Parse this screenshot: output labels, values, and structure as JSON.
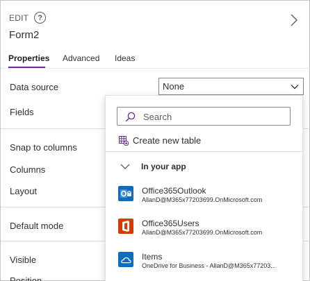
{
  "header": {
    "edit_label": "EDIT",
    "help_glyph": "?",
    "form_name": "Form2"
  },
  "tabs": [
    {
      "label": "Properties",
      "active": true
    },
    {
      "label": "Advanced",
      "active": false
    },
    {
      "label": "Ideas",
      "active": false
    }
  ],
  "properties": {
    "data_source": "Data source",
    "fields": "Fields",
    "snap_to_columns": "Snap to columns",
    "columns": "Columns",
    "layout": "Layout",
    "default_mode": "Default mode",
    "visible": "Visible",
    "position": "Position"
  },
  "data_source_select": {
    "value": "None"
  },
  "dropdown": {
    "search_placeholder": "Search",
    "create_new_table": "Create new table",
    "section_label": "In your app",
    "items": [
      {
        "name": "Office365Outlook",
        "sub": "AllanD@M365x77203699.OnMicrosoft.com",
        "icon": "outlook-icon"
      },
      {
        "name": "Office365Users",
        "sub": "AllanD@M365x77203699.OnMicrosoft.com",
        "icon": "office-icon"
      },
      {
        "name": "Items",
        "sub": "OneDrive for Business - AllanD@M365x77203...",
        "icon": "onedrive-icon"
      }
    ]
  },
  "colors": {
    "accent": "#6b2c91",
    "outlook": "#0f6cbd",
    "office": "#d83b01",
    "onedrive": "#0f6cbd"
  }
}
